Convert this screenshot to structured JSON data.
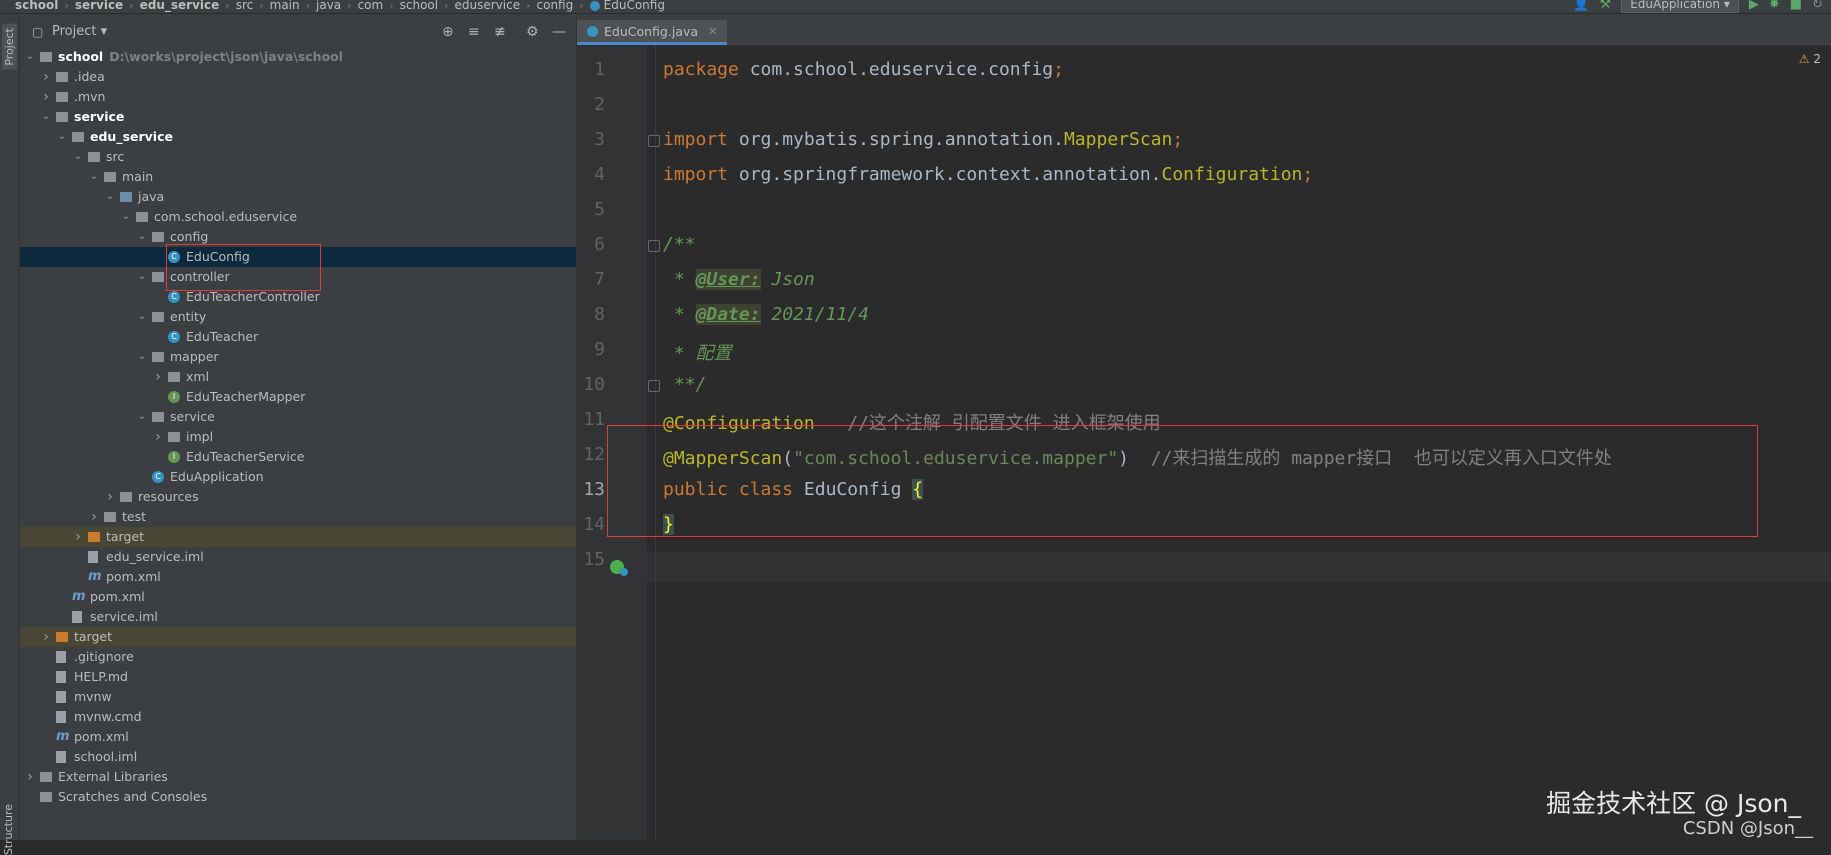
{
  "breadcrumb": {
    "items": [
      "school",
      "service",
      "edu_service",
      "src",
      "main",
      "java",
      "com",
      "school",
      "eduservice",
      "config",
      "EduConfig"
    ]
  },
  "toolbar": {
    "run_config": "EduApplication"
  },
  "side_strip": {
    "project_label": "Project",
    "structure_label": "Structure"
  },
  "project_panel": {
    "title": "Project",
    "root_path": "D:\\works\\project\\json\\java\\school",
    "tree": [
      {
        "label": "school",
        "indent": 0,
        "arrow": "open",
        "icon": "folder",
        "bold": true
      },
      {
        "label": ".idea",
        "indent": 1,
        "arrow": "closed",
        "icon": "folder"
      },
      {
        "label": ".mvn",
        "indent": 1,
        "arrow": "closed",
        "icon": "folder"
      },
      {
        "label": "service",
        "indent": 1,
        "arrow": "open",
        "icon": "folder",
        "bold": true
      },
      {
        "label": "edu_service",
        "indent": 2,
        "arrow": "open",
        "icon": "folder",
        "bold": true
      },
      {
        "label": "src",
        "indent": 3,
        "arrow": "open",
        "icon": "folder"
      },
      {
        "label": "main",
        "indent": 4,
        "arrow": "open",
        "icon": "folder"
      },
      {
        "label": "java",
        "indent": 5,
        "arrow": "open",
        "icon": "folder-blue"
      },
      {
        "label": "com.school.eduservice",
        "indent": 6,
        "arrow": "open",
        "icon": "folder"
      },
      {
        "label": "config",
        "indent": 7,
        "arrow": "open",
        "icon": "folder"
      },
      {
        "label": "EduConfig",
        "indent": 8,
        "arrow": "none",
        "icon": "class",
        "selected": true
      },
      {
        "label": "controller",
        "indent": 7,
        "arrow": "open",
        "icon": "folder"
      },
      {
        "label": "EduTeacherController",
        "indent": 8,
        "arrow": "none",
        "icon": "class"
      },
      {
        "label": "entity",
        "indent": 7,
        "arrow": "open",
        "icon": "folder"
      },
      {
        "label": "EduTeacher",
        "indent": 8,
        "arrow": "none",
        "icon": "class"
      },
      {
        "label": "mapper",
        "indent": 7,
        "arrow": "open",
        "icon": "folder"
      },
      {
        "label": "xml",
        "indent": 8,
        "arrow": "closed",
        "icon": "folder"
      },
      {
        "label": "EduTeacherMapper",
        "indent": 8,
        "arrow": "none",
        "icon": "interface"
      },
      {
        "label": "service",
        "indent": 7,
        "arrow": "open",
        "icon": "folder"
      },
      {
        "label": "impl",
        "indent": 8,
        "arrow": "closed",
        "icon": "folder"
      },
      {
        "label": "EduTeacherService",
        "indent": 8,
        "arrow": "none",
        "icon": "interface"
      },
      {
        "label": "EduApplication",
        "indent": 7,
        "arrow": "none",
        "icon": "class"
      },
      {
        "label": "resources",
        "indent": 5,
        "arrow": "closed",
        "icon": "folder"
      },
      {
        "label": "test",
        "indent": 4,
        "arrow": "closed",
        "icon": "folder"
      },
      {
        "label": "target",
        "indent": 3,
        "arrow": "closed",
        "icon": "folder-orange",
        "target": true
      },
      {
        "label": "edu_service.iml",
        "indent": 3,
        "arrow": "none",
        "icon": "file"
      },
      {
        "label": "pom.xml",
        "indent": 3,
        "arrow": "none",
        "icon": "maven"
      },
      {
        "label": "pom.xml",
        "indent": 2,
        "arrow": "none",
        "icon": "maven"
      },
      {
        "label": "service.iml",
        "indent": 2,
        "arrow": "none",
        "icon": "file"
      },
      {
        "label": "target",
        "indent": 1,
        "arrow": "closed",
        "icon": "folder-orange",
        "target": true
      },
      {
        "label": ".gitignore",
        "indent": 1,
        "arrow": "none",
        "icon": "file"
      },
      {
        "label": "HELP.md",
        "indent": 1,
        "arrow": "none",
        "icon": "file"
      },
      {
        "label": "mvnw",
        "indent": 1,
        "arrow": "none",
        "icon": "file"
      },
      {
        "label": "mvnw.cmd",
        "indent": 1,
        "arrow": "none",
        "icon": "file"
      },
      {
        "label": "pom.xml",
        "indent": 1,
        "arrow": "none",
        "icon": "maven"
      },
      {
        "label": "school.iml",
        "indent": 1,
        "arrow": "none",
        "icon": "file"
      },
      {
        "label": "External Libraries",
        "indent": 0,
        "arrow": "closed",
        "icon": "folder"
      },
      {
        "label": "Scratches and Consoles",
        "indent": 0,
        "arrow": "none",
        "icon": "folder"
      }
    ]
  },
  "editor": {
    "tab_label": "EduConfig.java",
    "warning_count": "2",
    "current_line": 13,
    "lines": [
      [
        {
          "t": "package ",
          "c": "kw"
        },
        {
          "t": "com.school.eduservice.config",
          "c": "cls"
        },
        {
          "t": ";",
          "c": "kw"
        }
      ],
      [],
      [
        {
          "t": "import ",
          "c": "kw"
        },
        {
          "t": "org.mybatis.spring.annotation.",
          "c": "cls"
        },
        {
          "t": "MapperScan",
          "c": "ytype"
        },
        {
          "t": ";",
          "c": "kw"
        }
      ],
      [
        {
          "t": "import ",
          "c": "kw"
        },
        {
          "t": "org.springframework.context.annotation.",
          "c": "cls"
        },
        {
          "t": "Configuration",
          "c": "ytype"
        },
        {
          "t": ";",
          "c": "kw"
        }
      ],
      [],
      [
        {
          "t": "/**",
          "c": "doc"
        }
      ],
      [
        {
          "t": " * ",
          "c": "doc"
        },
        {
          "t": "@User:",
          "c": "doctag"
        },
        {
          "t": " Json",
          "c": "doc"
        }
      ],
      [
        {
          "t": " * ",
          "c": "doc"
        },
        {
          "t": "@Date:",
          "c": "doctag"
        },
        {
          "t": " 2021/11/4",
          "c": "doc"
        }
      ],
      [
        {
          "t": " * 配置",
          "c": "doc"
        }
      ],
      [
        {
          "t": " **/",
          "c": "doc"
        }
      ],
      [
        {
          "t": "@Configuration",
          "c": "ann"
        },
        {
          "t": "   //这个注解 引配置文件 进入框架使用",
          "c": "cm"
        }
      ],
      [
        {
          "t": "@MapperScan",
          "c": "ann"
        },
        {
          "t": "(",
          "c": "cls"
        },
        {
          "t": "\"com.school.eduservice.mapper\"",
          "c": "str"
        },
        {
          "t": ")  ",
          "c": "cls"
        },
        {
          "t": "//来扫描生成的 mapper接口  也可以定义再入口文件处",
          "c": "cm"
        }
      ],
      [
        {
          "t": "public class ",
          "c": "kw"
        },
        {
          "t": "EduConfig ",
          "c": "cls"
        },
        {
          "t": "{",
          "c": "brace"
        }
      ],
      [
        {
          "t": "}",
          "c": "brace"
        }
      ],
      []
    ]
  },
  "watermark": {
    "line1": "掘金技术社区 @ Json_",
    "line2": "CSDN @Json__"
  }
}
